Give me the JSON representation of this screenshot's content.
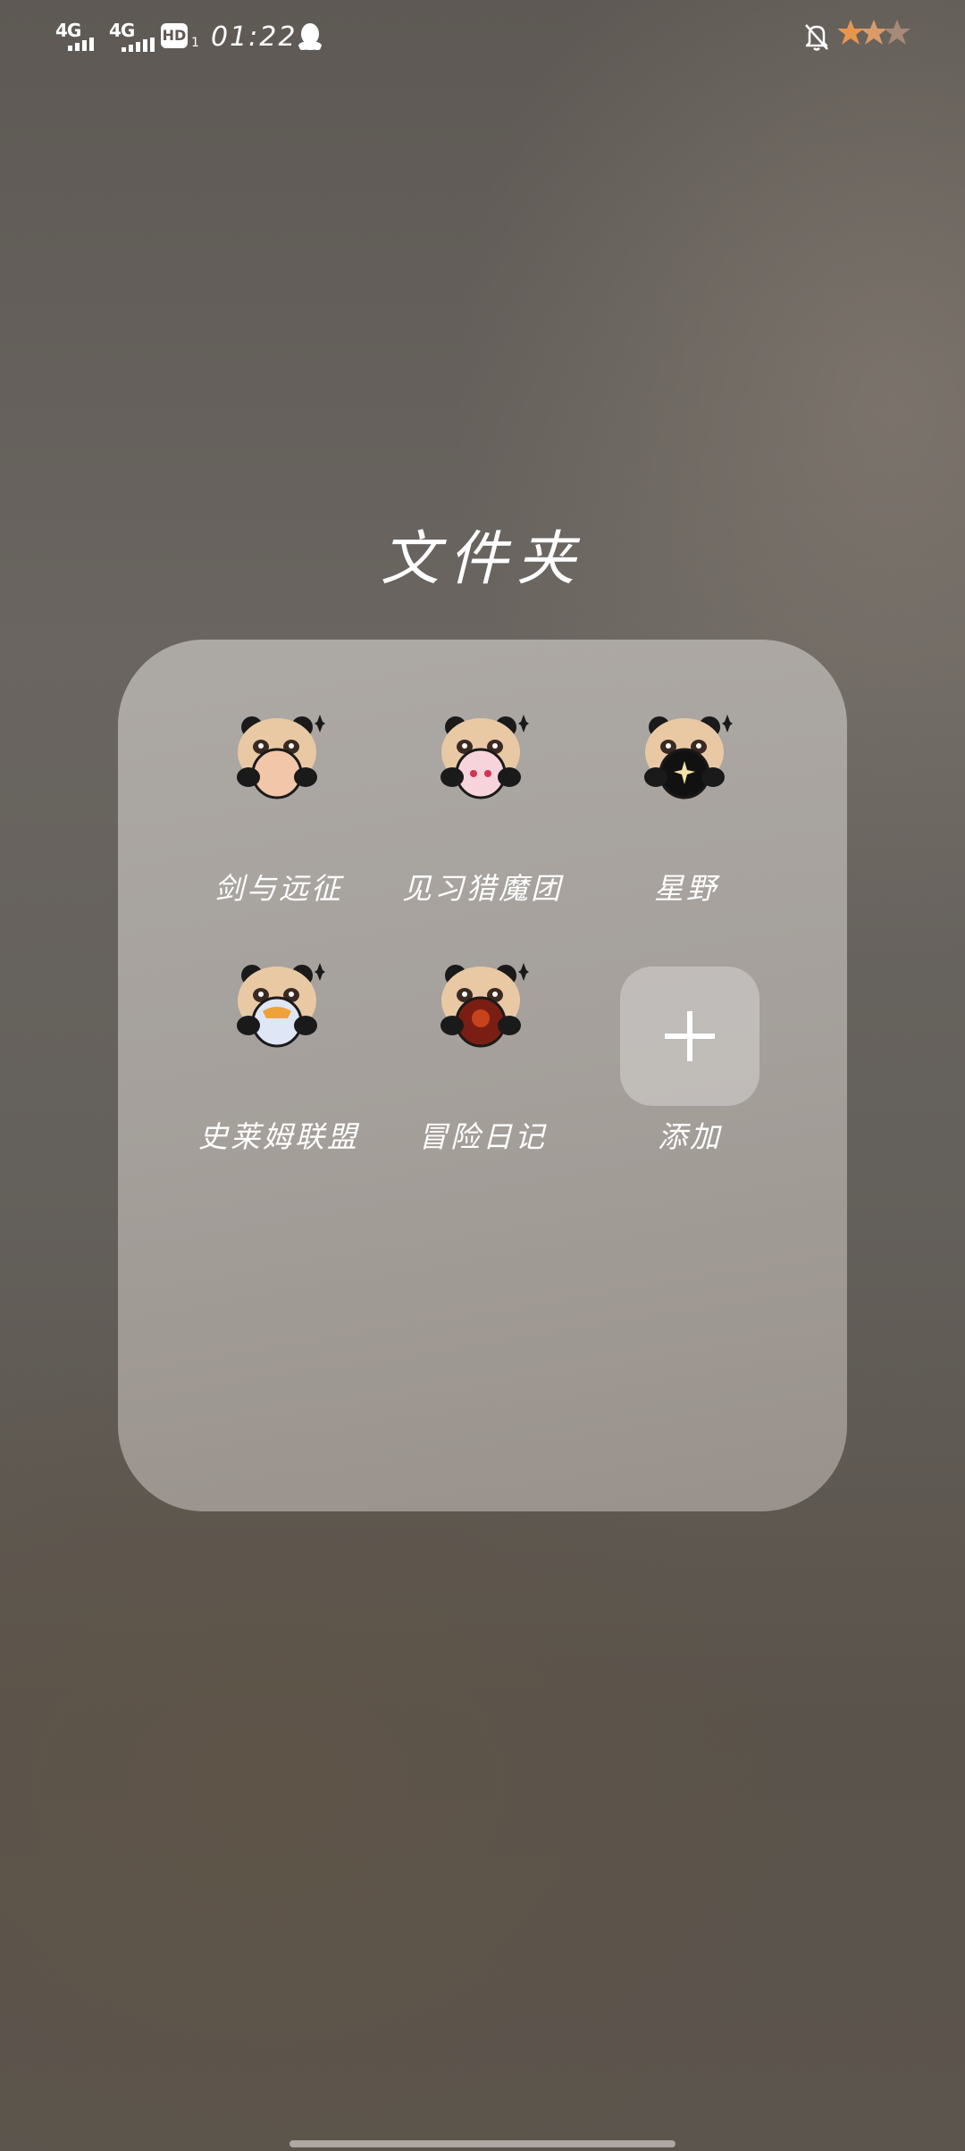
{
  "status_bar": {
    "signal1_label": "4G",
    "signal2_label": "4G",
    "hd_label": "HD",
    "hd_sub": "1",
    "time": "01:22",
    "icons": [
      "qq-penguin-icon",
      "bell-off-icon",
      "star-battery-icon"
    ]
  },
  "folder": {
    "title": "文件夹",
    "apps": [
      {
        "label": "剑与远征",
        "icon": "panda-avatar-icon",
        "badge_color": "#f2c6a8"
      },
      {
        "label": "见习猎魔团",
        "icon": "panda-avatar-icon",
        "badge_color": "#f7d3dc"
      },
      {
        "label": "星野",
        "icon": "panda-avatar-icon",
        "badge_color": "#111111"
      },
      {
        "label": "史莱姆联盟",
        "icon": "panda-avatar-icon",
        "badge_color": "#dfe6f5"
      },
      {
        "label": "冒险日记",
        "icon": "panda-avatar-icon",
        "badge_color": "#7a1e14"
      }
    ],
    "add_label": "添加"
  },
  "colors": {
    "panel": "#aeaaa6",
    "text": "#ffffff",
    "panda_fur": "#e9c9a4",
    "panda_black": "#1a1a1a"
  }
}
